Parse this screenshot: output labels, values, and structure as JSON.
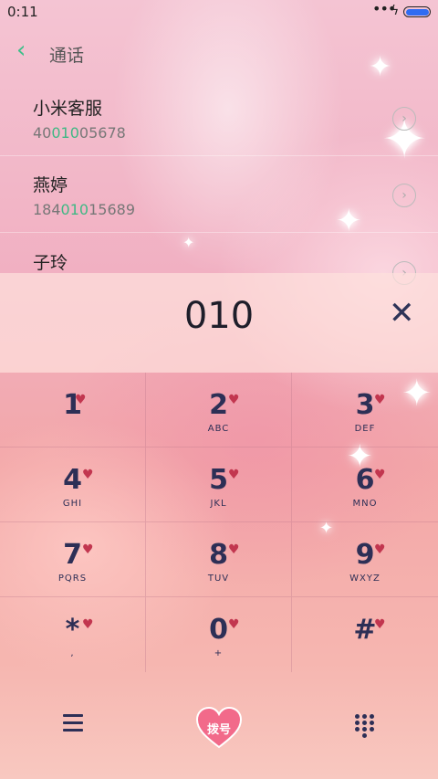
{
  "status_bar": {
    "time": "0:11",
    "signal": "•••",
    "charging": "ϟ",
    "battery_level": 1.0
  },
  "header": {
    "back_glyph": "‹",
    "title": "通话"
  },
  "contacts": [
    {
      "name": "小米客服",
      "number_pre": "40",
      "number_match": "010",
      "number_post": "05678"
    },
    {
      "name": "燕婷",
      "number_pre": "184",
      "number_match": "010",
      "number_post": "15689"
    },
    {
      "name": "子玲",
      "number_pre": "",
      "number_match": "",
      "number_post": ""
    }
  ],
  "info_glyph": "›",
  "input": {
    "digits": "010",
    "delete_glyph": "✕"
  },
  "keypad": [
    {
      "digit": "1",
      "letters": ""
    },
    {
      "digit": "2",
      "letters": "ABC"
    },
    {
      "digit": "3",
      "letters": "DEF"
    },
    {
      "digit": "4",
      "letters": "GHI"
    },
    {
      "digit": "5",
      "letters": "JKL"
    },
    {
      "digit": "6",
      "letters": "MNO"
    },
    {
      "digit": "7",
      "letters": "PQRS"
    },
    {
      "digit": "8",
      "letters": "TUV"
    },
    {
      "digit": "9",
      "letters": "WXYZ"
    },
    {
      "digit": "*",
      "letters": ","
    },
    {
      "digit": "0",
      "letters": "+"
    },
    {
      "digit": "#",
      "letters": ""
    }
  ],
  "heart_glyph": "♥",
  "bottom": {
    "call_label": "拨号"
  },
  "colors": {
    "accent_green": "#3fb884",
    "key_text": "#2d2f56",
    "heart": "#c2364f",
    "battery": "#2f6cf2"
  }
}
